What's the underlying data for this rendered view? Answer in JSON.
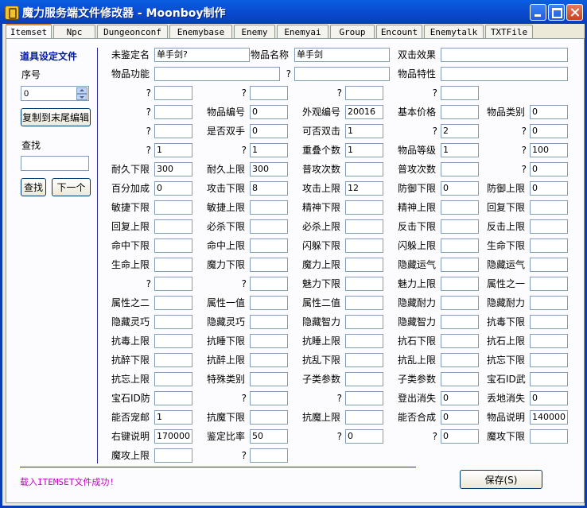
{
  "window": {
    "title": "魔力服务端文件修改器 - Moonboy制作"
  },
  "tabs": [
    "Itemset",
    "Npc",
    "Dungeonconf",
    "Enemybase",
    "Enemy",
    "Enemyai",
    "Group",
    "Encount",
    "Enemytalk",
    "TXTFile"
  ],
  "left": {
    "title": "道具设定文件",
    "index_label": "序号",
    "index_value": "0",
    "copy_button": "复制到末尾编辑",
    "search_label": "查找",
    "search_value": "",
    "search_button": "查找",
    "next_button": "下一个"
  },
  "rows": [
    [
      [
        "未鉴定名",
        "单手剑?"
      ],
      [
        "物品名称",
        "单手剑"
      ],
      [
        "双击效果",
        ""
      ]
    ],
    [
      [
        "物品功能",
        ""
      ],
      [
        "?",
        ""
      ],
      [
        "物品特性",
        ""
      ]
    ],
    [
      [
        "?",
        ""
      ],
      [
        "?",
        ""
      ],
      [
        "?",
        ""
      ],
      [
        "?",
        ""
      ]
    ],
    [
      [
        "?",
        ""
      ],
      [
        "物品编号",
        "0"
      ],
      [
        "外观编号",
        "20016"
      ],
      [
        "基本价格",
        ""
      ],
      [
        "物品类别",
        "0"
      ]
    ],
    [
      [
        "?",
        ""
      ],
      [
        "是否双手",
        "0"
      ],
      [
        "可否双击",
        "1"
      ],
      [
        "?",
        "2"
      ],
      [
        "?",
        "0"
      ]
    ],
    [
      [
        "?",
        "1"
      ],
      [
        "?",
        "1"
      ],
      [
        "重叠个数",
        "1"
      ],
      [
        "物品等级",
        "1"
      ],
      [
        "?",
        "100"
      ]
    ],
    [
      [
        "耐久下限",
        "300"
      ],
      [
        "耐久上限",
        "300"
      ],
      [
        "普攻次数",
        ""
      ],
      [
        "普攻次数",
        ""
      ],
      [
        "?",
        "0"
      ]
    ],
    [
      [
        "百分加成",
        "0"
      ],
      [
        "攻击下限",
        "8"
      ],
      [
        "攻击上限",
        "12"
      ],
      [
        "防御下限",
        "0"
      ],
      [
        "防御上限",
        "0"
      ]
    ],
    [
      [
        "敏捷下限",
        ""
      ],
      [
        "敏捷上限",
        ""
      ],
      [
        "精神下限",
        ""
      ],
      [
        "精神上限",
        ""
      ],
      [
        "回复下限",
        ""
      ]
    ],
    [
      [
        "回复上限",
        ""
      ],
      [
        "必杀下限",
        ""
      ],
      [
        "必杀上限",
        ""
      ],
      [
        "反击下限",
        ""
      ],
      [
        "反击上限",
        ""
      ]
    ],
    [
      [
        "命中下限",
        ""
      ],
      [
        "命中上限",
        ""
      ],
      [
        "闪躲下限",
        ""
      ],
      [
        "闪躲上限",
        ""
      ],
      [
        "生命下限",
        ""
      ]
    ],
    [
      [
        "生命上限",
        ""
      ],
      [
        "魔力下限",
        ""
      ],
      [
        "魔力上限",
        ""
      ],
      [
        "隐藏运气",
        ""
      ],
      [
        "隐藏运气",
        ""
      ]
    ],
    [
      [
        "?",
        ""
      ],
      [
        "?",
        ""
      ],
      [
        "魅力下限",
        ""
      ],
      [
        "魅力上限",
        ""
      ],
      [
        "属性之一",
        ""
      ]
    ],
    [
      [
        "属性之二",
        ""
      ],
      [
        "属性一值",
        ""
      ],
      [
        "属性二值",
        ""
      ],
      [
        "隐藏耐力",
        ""
      ],
      [
        "隐藏耐力",
        ""
      ]
    ],
    [
      [
        "隐藏灵巧",
        ""
      ],
      [
        "隐藏灵巧",
        ""
      ],
      [
        "隐藏智力",
        ""
      ],
      [
        "隐藏智力",
        ""
      ],
      [
        "抗毒下限",
        ""
      ]
    ],
    [
      [
        "抗毒上限",
        ""
      ],
      [
        "抗睡下限",
        ""
      ],
      [
        "抗睡上限",
        ""
      ],
      [
        "抗石下限",
        ""
      ],
      [
        "抗石上限",
        ""
      ]
    ],
    [
      [
        "抗醉下限",
        ""
      ],
      [
        "抗醉上限",
        ""
      ],
      [
        "抗乱下限",
        ""
      ],
      [
        "抗乱上限",
        ""
      ],
      [
        "抗忘下限",
        ""
      ]
    ],
    [
      [
        "抗忘上限",
        ""
      ],
      [
        "特殊类别",
        ""
      ],
      [
        "子类参数",
        ""
      ],
      [
        "子类参数",
        ""
      ],
      [
        "宝石ID武",
        ""
      ]
    ],
    [
      [
        "宝石ID防",
        ""
      ],
      [
        "?",
        ""
      ],
      [
        "?",
        ""
      ],
      [
        "登出消失",
        "0"
      ],
      [
        "丢地消失",
        "0"
      ]
    ],
    [
      [
        "能否宠邮",
        "1"
      ],
      [
        "抗魔下限",
        ""
      ],
      [
        "抗魔上限",
        ""
      ],
      [
        "能否合成",
        "0"
      ],
      [
        "物品说明",
        "140000"
      ]
    ],
    [
      [
        "右键说明",
        "170000"
      ],
      [
        "鉴定比率",
        "50"
      ],
      [
        "?",
        "0"
      ],
      [
        "?",
        "0"
      ],
      [
        "魔攻下限",
        ""
      ]
    ],
    [
      [
        "魔攻上限",
        ""
      ],
      [
        "?",
        ""
      ]
    ]
  ],
  "status": "载入ITEMSET文件成功!",
  "save_button": "保存(S)"
}
